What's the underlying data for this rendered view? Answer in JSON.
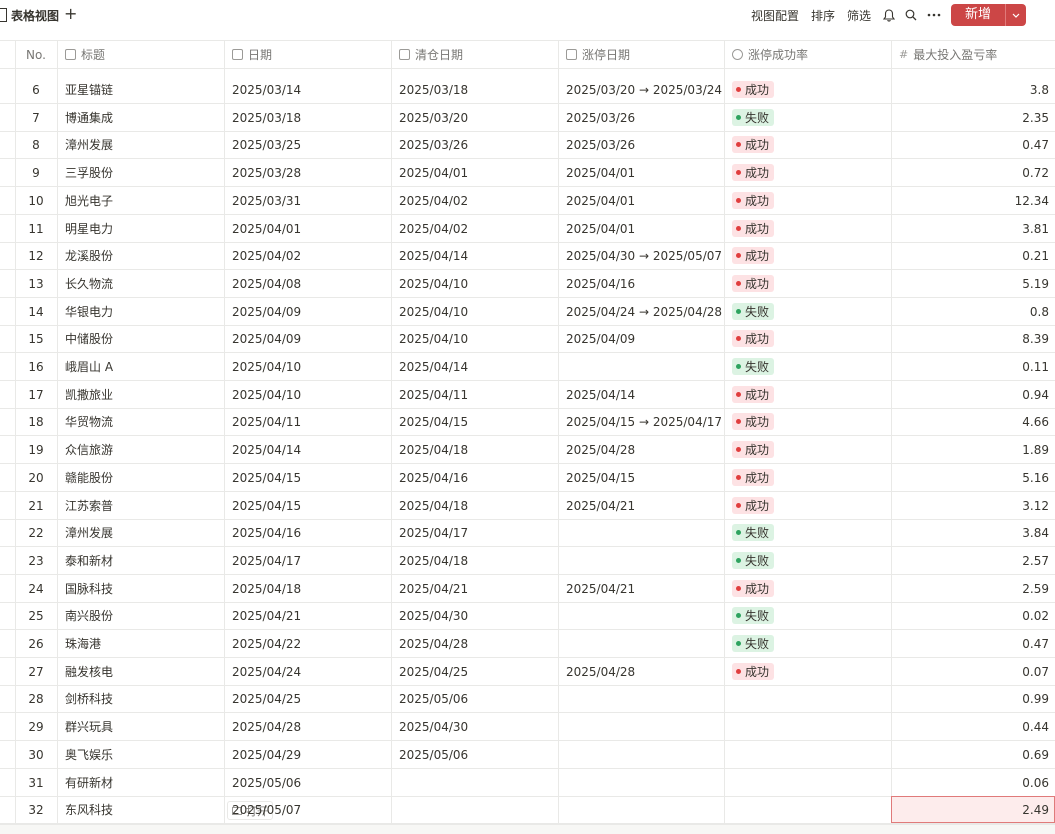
{
  "view": {
    "title": "表格视图",
    "add_label": "+"
  },
  "toolbar": {
    "view_config": "视图配置",
    "sort": "排序",
    "filter": "筛选",
    "new_label": "新增"
  },
  "columns": {
    "no": "No.",
    "title": "标题",
    "date": "日期",
    "close_date": "清仓日期",
    "limit_date": "涨停日期",
    "rate": "涨停成功率",
    "max_ratio": "最大投入盈亏率"
  },
  "open_label": "打开",
  "colors": {
    "success_bg": "#fde2e4",
    "success_dot": "#e03e3e",
    "fail_bg": "#dcf3e3",
    "fail_dot": "#2ea35f",
    "accent": "#cc4646"
  },
  "rows": [
    {
      "no": "6",
      "title": "亚星锚链",
      "date": "2025/03/14",
      "close": "2025/03/18",
      "limit": "2025/03/20 → 2025/03/24",
      "status": "成功",
      "type": "success",
      "ratio": "3.8"
    },
    {
      "no": "7",
      "title": "博通集成",
      "date": "2025/03/18",
      "close": "2025/03/20",
      "limit": "2025/03/26",
      "status": "失败",
      "type": "fail",
      "ratio": "2.35"
    },
    {
      "no": "8",
      "title": "漳州发展",
      "date": "2025/03/25",
      "close": "2025/03/26",
      "limit": "2025/03/26",
      "status": "成功",
      "type": "success",
      "ratio": "0.47"
    },
    {
      "no": "9",
      "title": "三孚股份",
      "date": "2025/03/28",
      "close": "2025/04/01",
      "limit": "2025/04/01",
      "status": "成功",
      "type": "success",
      "ratio": "0.72"
    },
    {
      "no": "10",
      "title": "旭光电子",
      "date": "2025/03/31",
      "close": "2025/04/02",
      "limit": "2025/04/01",
      "status": "成功",
      "type": "success",
      "ratio": "12.34"
    },
    {
      "no": "11",
      "title": "明星电力",
      "date": "2025/04/01",
      "close": "2025/04/02",
      "limit": "2025/04/01",
      "status": "成功",
      "type": "success",
      "ratio": "3.81"
    },
    {
      "no": "12",
      "title": "龙溪股份",
      "date": "2025/04/02",
      "close": "2025/04/14",
      "limit": "2025/04/30 → 2025/05/07",
      "status": "成功",
      "type": "success",
      "ratio": "0.21"
    },
    {
      "no": "13",
      "title": "长久物流",
      "date": "2025/04/08",
      "close": "2025/04/10",
      "limit": "2025/04/16",
      "status": "成功",
      "type": "success",
      "ratio": "5.19"
    },
    {
      "no": "14",
      "title": "华银电力",
      "date": "2025/04/09",
      "close": "2025/04/10",
      "limit": "2025/04/24 → 2025/04/28",
      "status": "失败",
      "type": "fail",
      "ratio": "0.8"
    },
    {
      "no": "15",
      "title": "中储股份",
      "date": "2025/04/09",
      "close": "2025/04/10",
      "limit": "2025/04/09",
      "status": "成功",
      "type": "success",
      "ratio": "8.39"
    },
    {
      "no": "16",
      "title": "峨眉山 A",
      "date": "2025/04/10",
      "close": "2025/04/14",
      "limit": "",
      "status": "失败",
      "type": "fail",
      "ratio": "0.11"
    },
    {
      "no": "17",
      "title": "凯撒旅业",
      "date": "2025/04/10",
      "close": "2025/04/11",
      "limit": "2025/04/14",
      "status": "成功",
      "type": "success",
      "ratio": "0.94"
    },
    {
      "no": "18",
      "title": "华贸物流",
      "date": "2025/04/11",
      "close": "2025/04/15",
      "limit": "2025/04/15 → 2025/04/17",
      "status": "成功",
      "type": "success",
      "ratio": "4.66"
    },
    {
      "no": "19",
      "title": "众信旅游",
      "date": "2025/04/14",
      "close": "2025/04/18",
      "limit": "2025/04/28",
      "status": "成功",
      "type": "success",
      "ratio": "1.89"
    },
    {
      "no": "20",
      "title": "赣能股份",
      "date": "2025/04/15",
      "close": "2025/04/16",
      "limit": "2025/04/15",
      "status": "成功",
      "type": "success",
      "ratio": "5.16"
    },
    {
      "no": "21",
      "title": "江苏索普",
      "date": "2025/04/15",
      "close": "2025/04/18",
      "limit": "2025/04/21",
      "status": "成功",
      "type": "success",
      "ratio": "3.12"
    },
    {
      "no": "22",
      "title": "漳州发展",
      "date": "2025/04/16",
      "close": "2025/04/17",
      "limit": "",
      "status": "失败",
      "type": "fail",
      "ratio": "3.84"
    },
    {
      "no": "23",
      "title": "泰和新材",
      "date": "2025/04/17",
      "close": "2025/04/18",
      "limit": "",
      "status": "失败",
      "type": "fail",
      "ratio": "2.57"
    },
    {
      "no": "24",
      "title": "国脉科技",
      "date": "2025/04/18",
      "close": "2025/04/21",
      "limit": "2025/04/21",
      "status": "成功",
      "type": "success",
      "ratio": "2.59"
    },
    {
      "no": "25",
      "title": "南兴股份",
      "date": "2025/04/21",
      "close": "2025/04/30",
      "limit": "",
      "status": "失败",
      "type": "fail",
      "ratio": "0.02"
    },
    {
      "no": "26",
      "title": "珠海港",
      "date": "2025/04/22",
      "close": "2025/04/28",
      "limit": "",
      "status": "失败",
      "type": "fail",
      "ratio": "0.47"
    },
    {
      "no": "27",
      "title": "融发核电",
      "date": "2025/04/24",
      "close": "2025/04/25",
      "limit": "2025/04/28",
      "status": "成功",
      "type": "success",
      "ratio": "0.07"
    },
    {
      "no": "28",
      "title": "剑桥科技",
      "date": "2025/04/25",
      "close": "2025/05/06",
      "limit": "",
      "status": "",
      "type": "",
      "ratio": "0.99"
    },
    {
      "no": "29",
      "title": "群兴玩具",
      "date": "2025/04/28",
      "close": "2025/04/30",
      "limit": "",
      "status": "",
      "type": "",
      "ratio": "0.44"
    },
    {
      "no": "30",
      "title": "奥飞娱乐",
      "date": "2025/04/29",
      "close": "2025/05/06",
      "limit": "",
      "status": "",
      "type": "",
      "ratio": "0.69"
    },
    {
      "no": "31",
      "title": "有研新材",
      "date": "2025/05/06",
      "close": "",
      "limit": "",
      "status": "",
      "type": "",
      "ratio": "0.06"
    },
    {
      "no": "32",
      "title": "东风科技",
      "date": "2025/05/07",
      "close": "",
      "limit": "",
      "status": "",
      "type": "",
      "ratio": "2.49"
    }
  ]
}
